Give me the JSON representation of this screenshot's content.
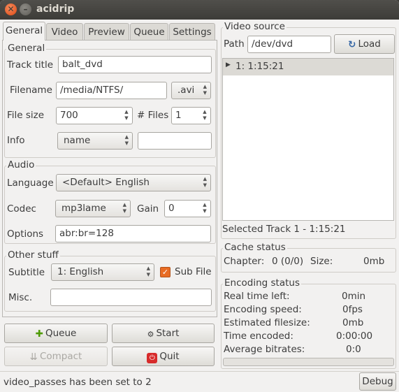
{
  "window": {
    "title": "acidrip"
  },
  "tabs": [
    "General",
    "Video",
    "Preview",
    "Queue",
    "Settings"
  ],
  "general": {
    "frame_label": "General",
    "track_title_label": "Track title",
    "track_title_value": "balt_dvd",
    "filename_label": "Filename",
    "filename_value": "/media/NTFS/",
    "extension_value": ".avi",
    "file_size_label": "File size",
    "file_size_value": "700",
    "files_label": "# Files",
    "files_value": "1",
    "info_label": "Info",
    "info_value": "name",
    "info_text_value": ""
  },
  "audio": {
    "frame_label": "Audio",
    "language_label": "Language",
    "language_value": "<Default> English",
    "codec_label": "Codec",
    "codec_value": "mp3lame",
    "gain_label": "Gain",
    "gain_value": "0",
    "options_label": "Options",
    "options_value": "abr:br=128"
  },
  "other": {
    "frame_label": "Other stuff",
    "subtitle_label": "Subtitle",
    "subtitle_value": "1: English",
    "sub_file_label": "Sub File",
    "sub_file_checked": true,
    "misc_label": "Misc.",
    "misc_value": ""
  },
  "buttons": {
    "queue": "Queue",
    "start": "Start",
    "compact": "Compact",
    "quit": "Quit",
    "load": "Load",
    "debug": "Debug"
  },
  "video_source": {
    "frame_label": "Video source",
    "path_label": "Path",
    "path_value": "/dev/dvd",
    "tree_item": "1: 1:15:21",
    "selected_track": "Selected Track 1 - 1:15:21"
  },
  "cache_status": {
    "frame_label": "Cache status",
    "chapter_label": "Chapter:",
    "chapter_value": "0 (0/0)",
    "size_label": "Size:",
    "size_value": "0mb"
  },
  "encoding_status": {
    "frame_label": "Encoding status",
    "rows": [
      {
        "label": "Real time left:",
        "value": "0min"
      },
      {
        "label": "Encoding speed:",
        "value": "0fps"
      },
      {
        "label": "Estimated filesize:",
        "value": "0mb"
      },
      {
        "label": "Time encoded:",
        "value": "0:00:00"
      },
      {
        "label": "Average bitrates:",
        "value": "0:0"
      }
    ],
    "progress": 0
  },
  "statusbar": {
    "message": "video_passes has been set to 2"
  },
  "colors": {
    "accent": "#e86c24",
    "titlebar": "#3d3c38"
  }
}
